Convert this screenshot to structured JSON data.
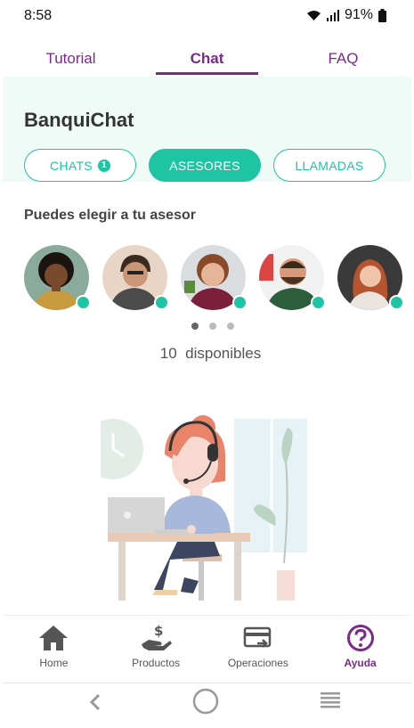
{
  "status_bar": {
    "time": "8:58",
    "battery": "91%",
    "icons": [
      "wifi-icon",
      "signal-icon",
      "battery-icon"
    ]
  },
  "tabs": [
    {
      "label": "Tutorial",
      "active": false
    },
    {
      "label": "Chat",
      "active": true
    },
    {
      "label": "FAQ",
      "active": false
    }
  ],
  "header": {
    "title": "BanquiChat"
  },
  "segments": {
    "chats": {
      "label": "CHATS",
      "badge": "1"
    },
    "asesores": {
      "label": "ASESORES",
      "selected": true
    },
    "llamadas": {
      "label": "LLAMADAS"
    }
  },
  "advisors_section": {
    "title": "Puedes elegir a tu asesor",
    "available_count": "10",
    "available_label": "disponibles",
    "page_count": 3,
    "current_page": 1
  },
  "bottom_nav": [
    {
      "label": "Home",
      "icon": "home-icon",
      "active": false
    },
    {
      "label": "Productos",
      "icon": "money-hand-icon",
      "active": false
    },
    {
      "label": "Operaciones",
      "icon": "card-transfer-icon",
      "active": false
    },
    {
      "label": "Ayuda",
      "icon": "help-circle-icon",
      "active": true
    }
  ],
  "colors": {
    "brand_purple": "#7b2a8c",
    "accent_green": "#1ec4a4",
    "header_bg": "#f0faf7"
  }
}
